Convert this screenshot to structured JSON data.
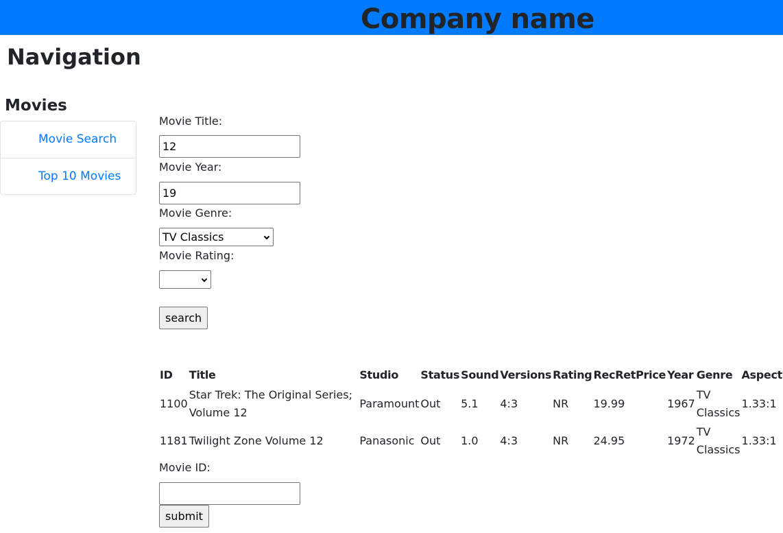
{
  "header": {
    "company_name": "Company name",
    "background_color": "#007bff"
  },
  "navigation": {
    "heading": "Navigation",
    "section_heading": "Movies",
    "items": [
      {
        "label": "Movie Search"
      },
      {
        "label": "Top 10 Movies"
      }
    ],
    "link_color": "#007bff"
  },
  "search_form": {
    "title_label": "Movie Title:",
    "title_value": "12",
    "year_label": "Movie Year:",
    "year_value": "19",
    "genre_label": "Movie Genre:",
    "genre_selected": "TV Classics",
    "rating_label": "Movie Rating:",
    "rating_selected": "",
    "search_button": "search"
  },
  "results": {
    "columns": [
      "ID",
      "Title",
      "Studio",
      "Status",
      "Sound",
      "Versions",
      "Rating",
      "RecRetPrice",
      "Year",
      "Genre",
      "Aspect"
    ],
    "rows": [
      {
        "id": "1100",
        "title": "Star Trek: The Original Series; Volume 12",
        "studio": "Paramount",
        "status": "Out",
        "sound": "5.1",
        "versions": "4:3",
        "rating": "NR",
        "price": "19.99",
        "year": "1967",
        "genre": "TV Classics",
        "aspect": "1.33:1"
      },
      {
        "id": "1181",
        "title": "Twilight Zone Volume 12",
        "studio": "Panasonic",
        "status": "Out",
        "sound": "1.0",
        "versions": "4:3",
        "rating": "NR",
        "price": "24.95",
        "year": "1972",
        "genre": "TV Classics",
        "aspect": "1.33:1"
      }
    ]
  },
  "submit_form": {
    "id_label": "Movie ID:",
    "id_value": "",
    "submit_button": "submit"
  }
}
